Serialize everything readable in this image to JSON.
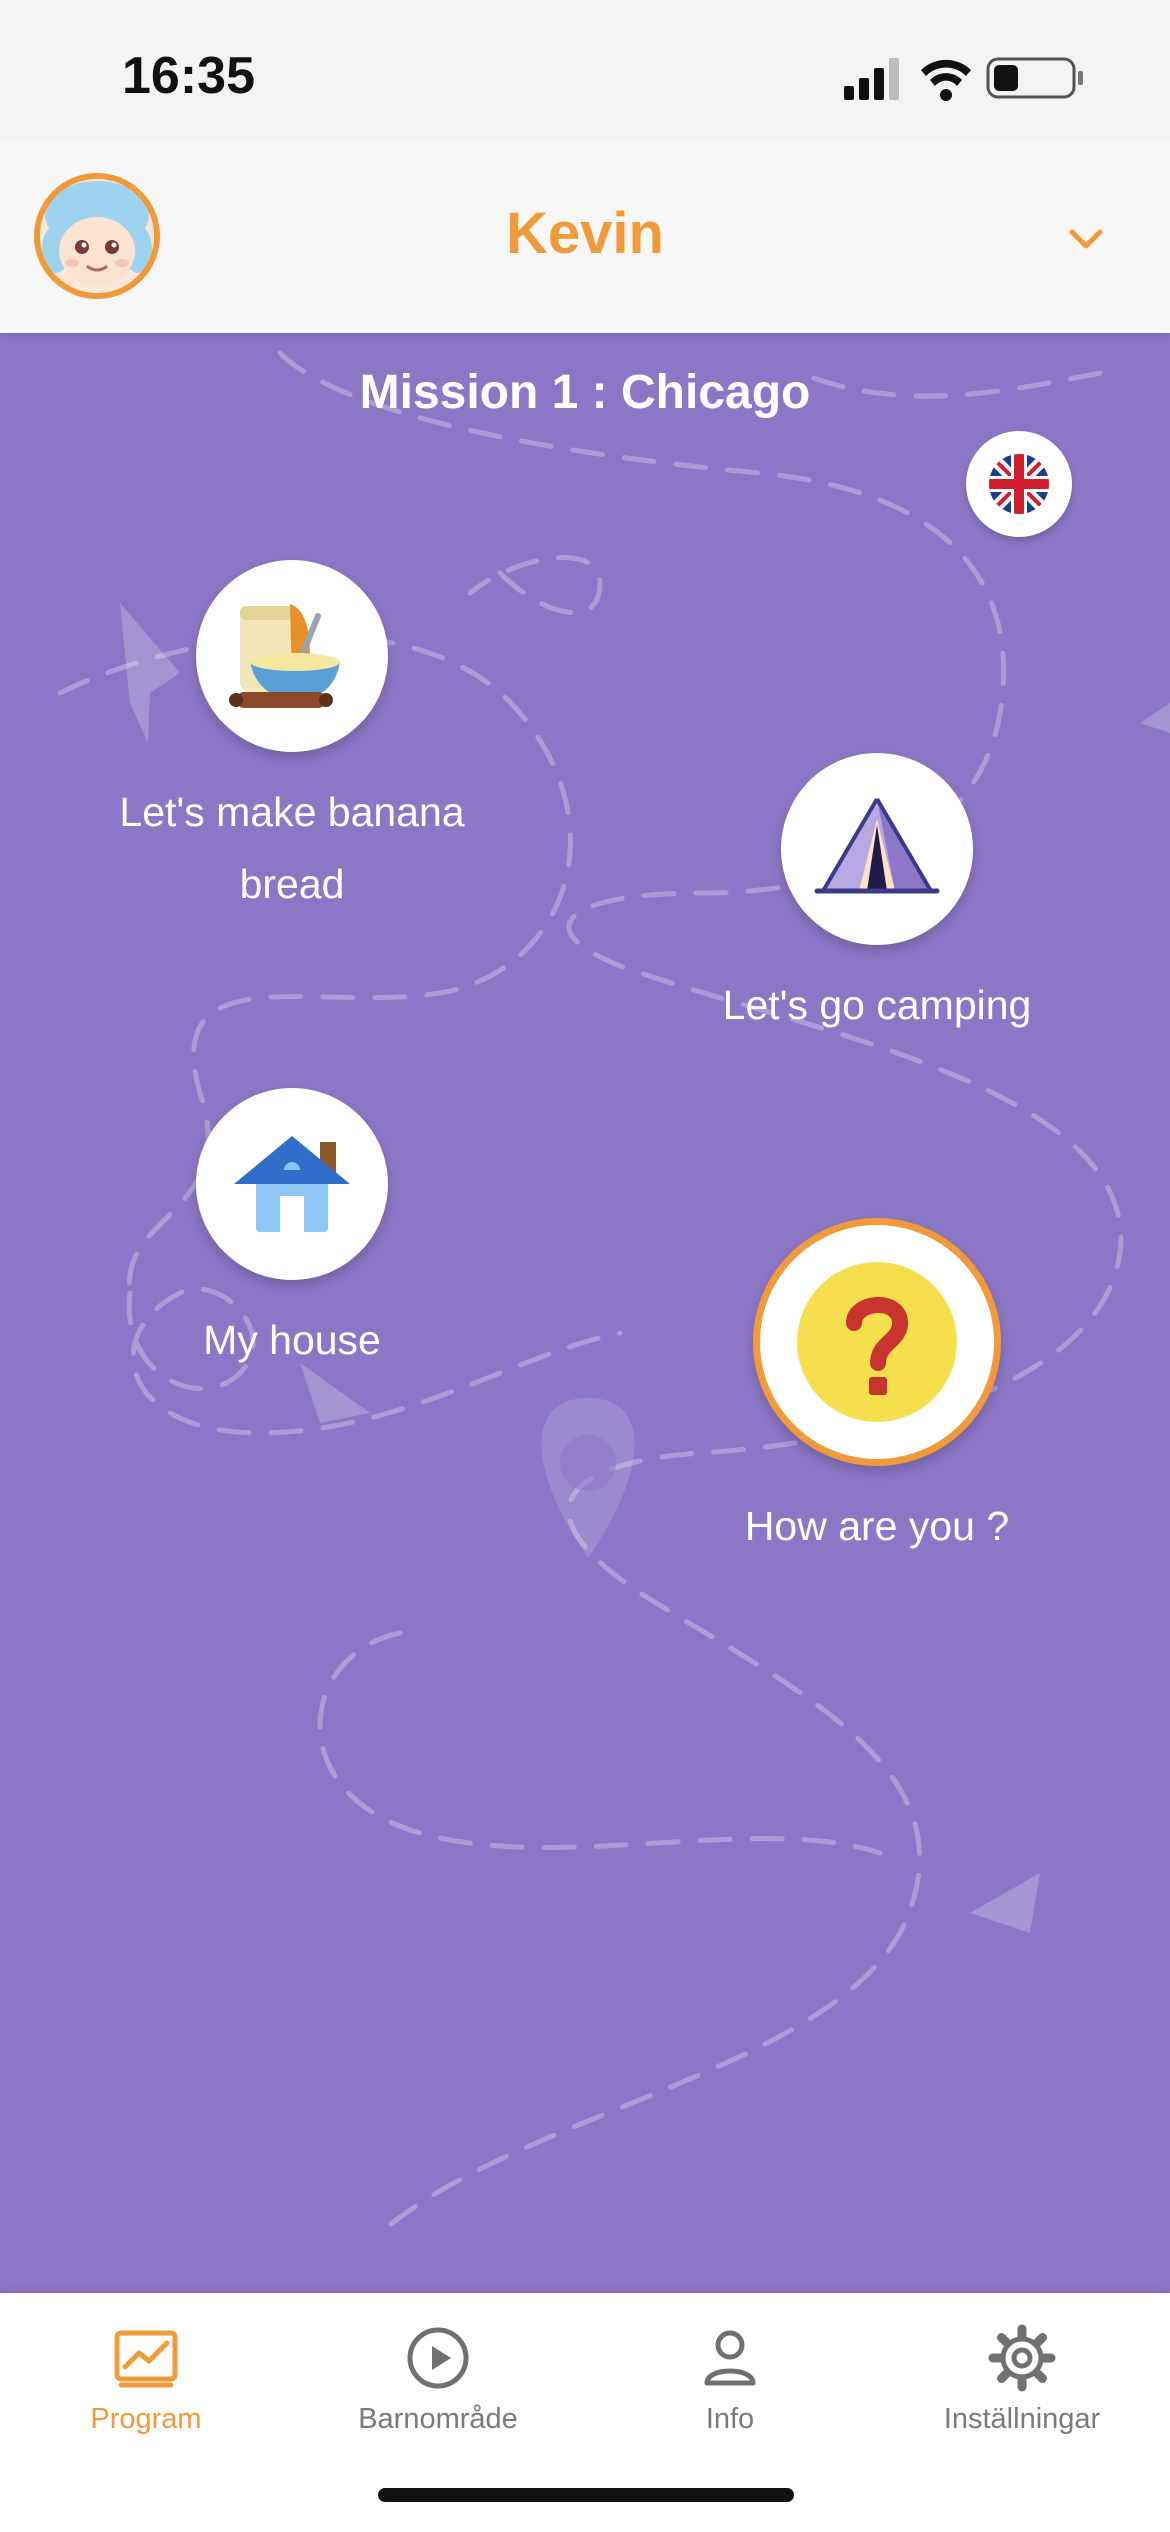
{
  "status": {
    "time": "16:35"
  },
  "header": {
    "user_name": "Kevin"
  },
  "map": {
    "mission_title": "Mission 1 : Chicago",
    "language": "English (UK)",
    "lessons": [
      {
        "label": "Let's make banana bread",
        "icon": "banana-bread-icon",
        "state": "available"
      },
      {
        "label": "Let's go camping",
        "icon": "tent-icon",
        "state": "available"
      },
      {
        "label": "My house",
        "icon": "house-icon",
        "state": "available"
      },
      {
        "label": "How are you ?",
        "icon": "question-mark-icon",
        "state": "current"
      }
    ]
  },
  "tabs": [
    {
      "label": "Program",
      "icon": "chart-icon",
      "active": true
    },
    {
      "label": "Barnområde",
      "icon": "play-circle-icon",
      "active": false
    },
    {
      "label": "Info",
      "icon": "person-icon",
      "active": false
    },
    {
      "label": "Inställningar",
      "icon": "gear-icon",
      "active": false
    }
  ],
  "colors": {
    "accent": "#f09a3a",
    "map_background": "#8c77c6"
  }
}
